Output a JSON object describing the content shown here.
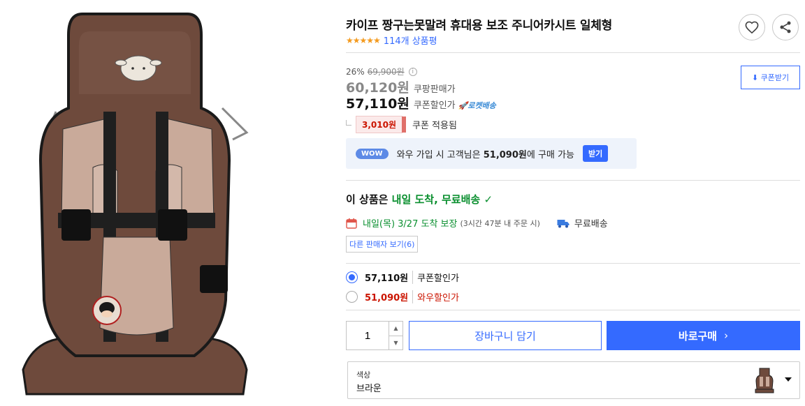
{
  "product": {
    "title": "카이프 짱구는못말려 휴대용 보조 주니어카시트 일체형",
    "stars": "★★★★★",
    "review_count": "114개 상품평"
  },
  "pricing": {
    "discount_rate": "26%",
    "original_price": "69,900원",
    "info_glyph": "i",
    "sale_price": "60,120원",
    "sale_label": "쿠팡판매가",
    "coupon_price": "57,110원",
    "coupon_label": "쿠폰할인가",
    "rocket_label": "🚀로켓배송",
    "coupon_button": "⬇ 쿠폰받기",
    "coupon_amount": "3,010원",
    "coupon_applied": "쿠폰 적용됨"
  },
  "wow": {
    "badge": "WOW",
    "text_before": "와우 가입 시 고객님은 ",
    "price": "51,090원",
    "text_after": "에 구매 가능",
    "button": "받기"
  },
  "delivery": {
    "headline_prefix": "이 상품은 ",
    "headline_highlight": "내일 도착, 무료배송",
    "check": "✓",
    "arrival": "내일(목) 3/27 도착 보장",
    "arrival_note": "(3시간 47분 내 주문 시)",
    "shipping": "무료배송",
    "other_sellers": "다른 판매자 보기(6)"
  },
  "options": [
    {
      "price": "57,110원",
      "label": "쿠폰할인가",
      "selected": true
    },
    {
      "price": "51,090원",
      "label": "와우할인가",
      "selected": false
    }
  ],
  "purchase": {
    "quantity": "1",
    "up_glyph": "▲",
    "down_glyph": "▼",
    "cart_button": "장바구니 담기",
    "buy_button": "바로구매",
    "buy_chevron": "›"
  },
  "variant": {
    "label": "색상",
    "value": "브라운"
  },
  "colors": {
    "accent": "#346aff",
    "price_red": "#cb1400",
    "delivery_green": "#0a8f2f",
    "star_orange": "#f49b1f",
    "seat_brown": "#6e4a3c",
    "seat_beige": "#c9aa9a"
  }
}
